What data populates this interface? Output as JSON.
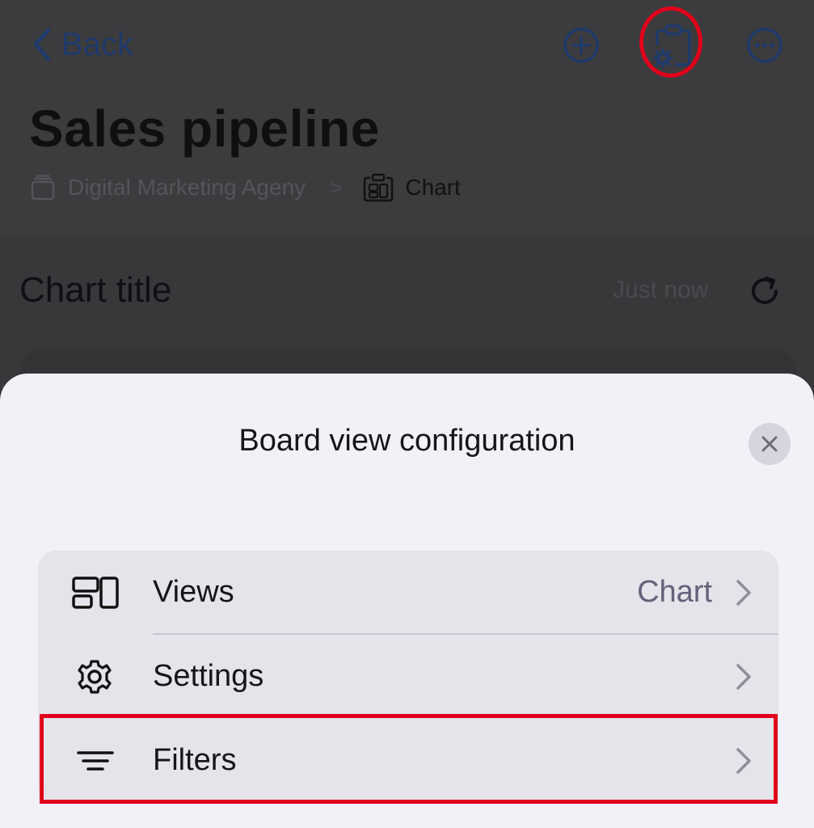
{
  "nav": {
    "back_label": "Back"
  },
  "page": {
    "title": "Sales pipeline"
  },
  "breadcrumb": {
    "workspace": "Digital Marketing Ageny",
    "separator": ">",
    "current": "Chart"
  },
  "chart_header": {
    "title": "Chart title",
    "updated": "Just now"
  },
  "sheet": {
    "title": "Board view configuration",
    "items": [
      {
        "label": "Views",
        "value": "Chart",
        "icon": "views-icon"
      },
      {
        "label": "Settings",
        "value": "",
        "icon": "gear-icon"
      },
      {
        "label": "Filters",
        "value": "",
        "icon": "filter-icon"
      }
    ]
  },
  "colors": {
    "accent": "#1f3a6b",
    "annotation": "#e1001a",
    "sheet_bg": "#f2f1f7",
    "menu_bg": "#e5e4eb"
  }
}
